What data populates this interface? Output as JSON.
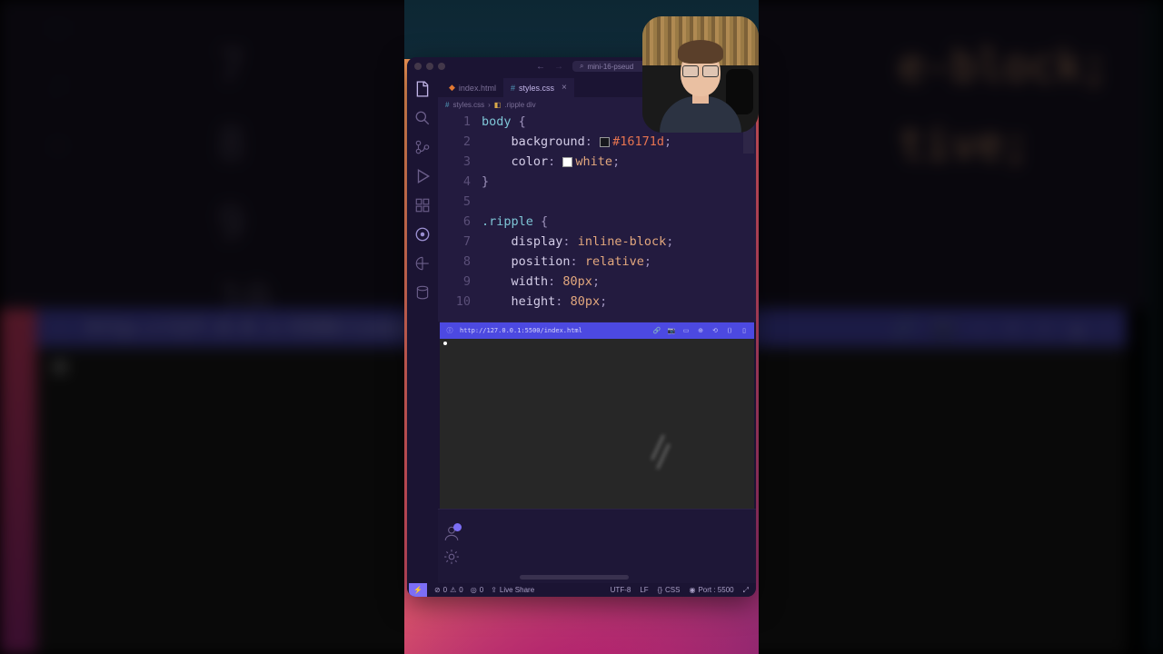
{
  "bg": {
    "line_7": "7",
    "line_8": "8",
    "line_9": "9",
    "line_10": "10",
    "sample_text_1": "e-block;",
    "sample_text_2": "tive;",
    "url": "http://127.0.0.1:5500/index."
  },
  "titlebar": {
    "search_text": "mini-16-pseud"
  },
  "tabs": {
    "inactive": {
      "label": "index.html",
      "icon_color": "#e37933"
    },
    "active": {
      "label": "styles.css",
      "icon_color": "#519aba"
    }
  },
  "breadcrumb": {
    "file": "styles.css",
    "path": ".ripple div"
  },
  "code": {
    "lines": [
      "1",
      "2",
      "3",
      "4",
      "5",
      "6",
      "7",
      "8",
      "9",
      "10"
    ],
    "l1_sel": "body",
    "l1_brace": " {",
    "l2_prop": "background",
    "l2_val": "#16171d",
    "l2_swatch": "#16171d",
    "l3_prop": "color",
    "l3_val": "white",
    "l3_swatch": "#ffffff",
    "l4": "}",
    "l6_sel": ".ripple",
    "l6_brace": " {",
    "l7_prop": "display",
    "l7_val": "inline-block",
    "l8_prop": "position",
    "l8_val": "relative",
    "l9_prop": "width",
    "l9_val": "80px",
    "l10_prop": "height",
    "l10_val": "80px"
  },
  "browser": {
    "url": "http://127.0.0.1:5500/index.html"
  },
  "status": {
    "errors": "0",
    "warnings": "0",
    "port_fwd": "0",
    "live_share": "Live Share",
    "encoding": "UTF-8",
    "eol": "LF",
    "lang": "CSS",
    "port": "Port : 5500"
  },
  "icons": {
    "files": "files-icon",
    "search": "search-icon",
    "git": "git-icon",
    "debug": "debug-icon",
    "ext": "extensions-icon",
    "copilot": "copilot-icon",
    "remote": "remote-icon",
    "db": "database-icon",
    "account": "account-icon",
    "gear": "gear-icon"
  }
}
